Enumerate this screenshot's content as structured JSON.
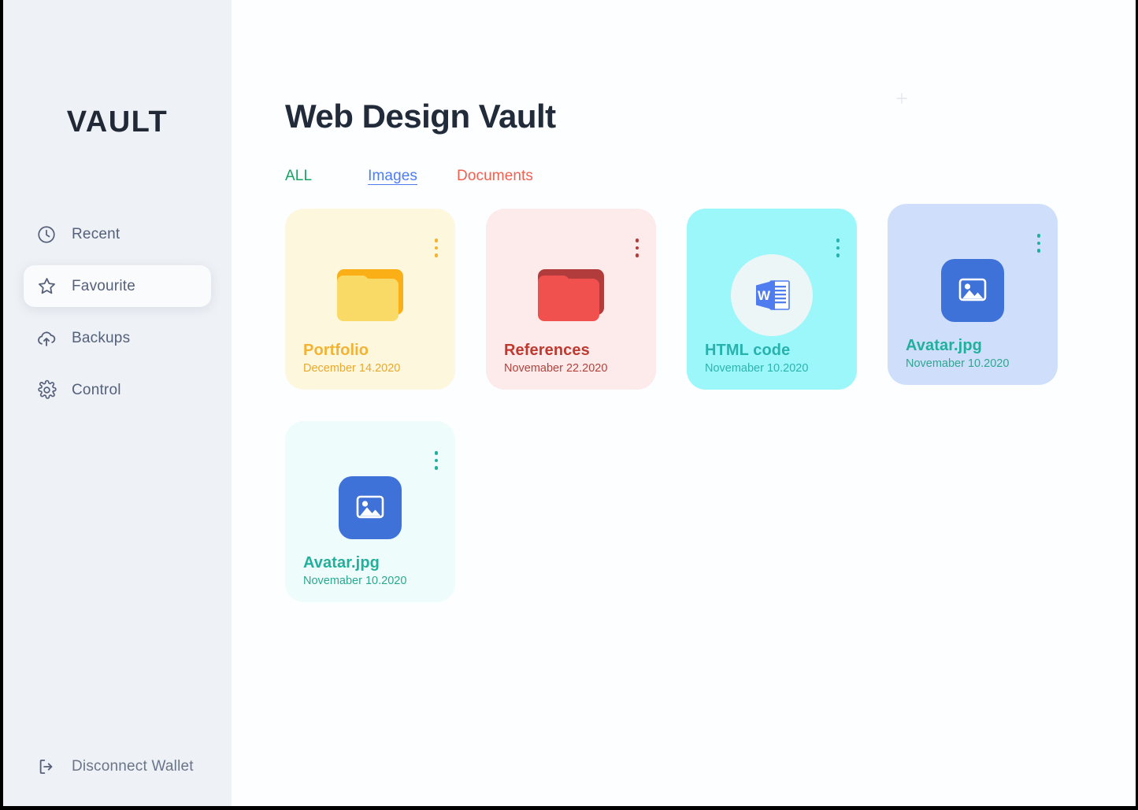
{
  "sidebar": {
    "brand": "VAULT",
    "items": [
      {
        "label": "Recent",
        "icon": "clock-icon"
      },
      {
        "label": "Favourite",
        "icon": "star-icon"
      },
      {
        "label": "Backups",
        "icon": "cloud-upload-icon"
      },
      {
        "label": "Control",
        "icon": "gear-icon"
      }
    ],
    "active_index": 1,
    "footer": {
      "label": "Disconnect Wallet",
      "icon": "logout-icon"
    }
  },
  "main": {
    "title": "Web Design Vault",
    "add_icon": "plus-icon",
    "tabs": [
      {
        "label": "ALL",
        "color": "#15a462",
        "active": false
      },
      {
        "label": "Images",
        "color": "#4f7df0",
        "active": true
      },
      {
        "label": "Documents",
        "color": "#f1604f",
        "active": false
      }
    ],
    "cards": [
      {
        "name": "Portfolio",
        "date": "December 14.2020",
        "icon": "folder-icon",
        "theme": "yellow",
        "bg": "#fdf7dd",
        "accent": "#f3b331"
      },
      {
        "name": "References",
        "date": "Novemaber 22.2020",
        "icon": "folder-icon",
        "theme": "red",
        "bg": "#fdeaea",
        "accent": "#c0392f"
      },
      {
        "name": "HTML code",
        "date": "Novemaber 10.2020",
        "icon": "word-document-icon",
        "theme": "cyan",
        "bg": "#9cf7fb",
        "accent": "#28b2ae"
      },
      {
        "name": "Avatar.jpg",
        "date": "Novemaber 10.2020",
        "icon": "image-file-icon",
        "theme": "blue",
        "bg": "#cfdffb",
        "accent": "#22b09c"
      },
      {
        "name": "Avatar.jpg",
        "date": "Novemaber 10.2020",
        "icon": "image-file-icon",
        "theme": "mint",
        "bg": "#eefcfb",
        "accent": "#22b09c"
      }
    ],
    "menu_icon": "three-dots-vertical-icon"
  }
}
